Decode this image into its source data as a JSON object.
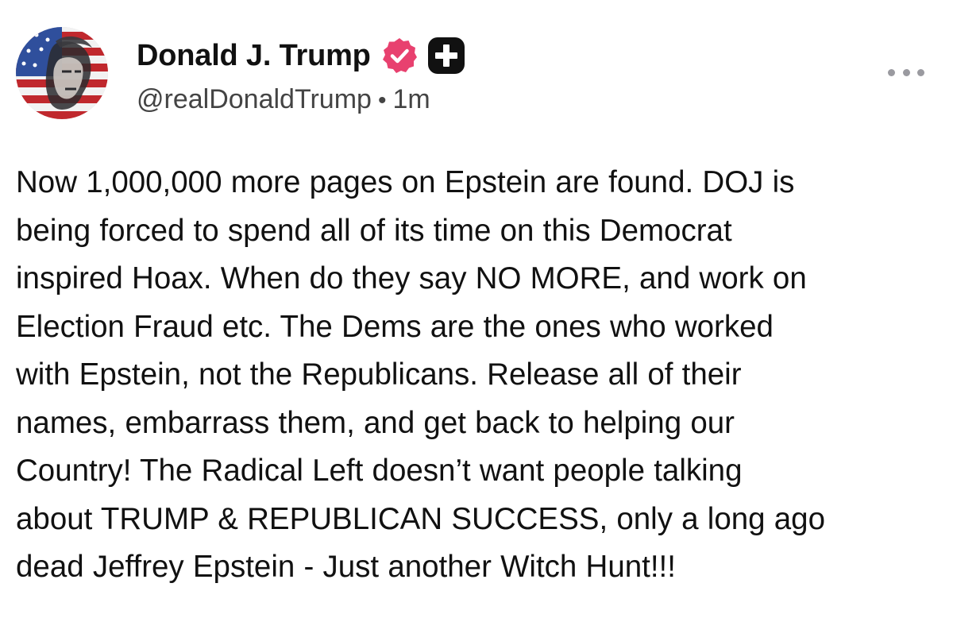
{
  "post": {
    "author": {
      "display_name": "Donald J. Trump",
      "handle": "@realDonaldTrump",
      "timestamp": "1m",
      "separator": "•",
      "verified_icon": "verified-badge-icon",
      "badge_icon": "plus-badge-icon",
      "avatar": "profile-avatar"
    },
    "more_icon": "more-options-icon",
    "body": "Now 1,000,000 more pages on Epstein are found. DOJ is\nbeing forced to spend all of its time on this Democrat\ninspired Hoax. When do they say NO MORE, and work on\nElection Fraud etc. The Dems are the ones who worked\nwith Epstein, not the Republicans. Release all of their\nnames, embarrass them, and get back to helping our\nCountry! The Radical Left doesn’t want people talking\nabout TRUMP & REPUBLICAN SUCCESS, only a long ago\ndead Jeffrey Epstein - Just another Witch Hunt!!!"
  },
  "colors": {
    "verified_badge": "#e8416f",
    "plus_badge": "#111111",
    "text": "#111111",
    "secondary_text": "#444444",
    "more_dots": "#9a9aa0"
  }
}
